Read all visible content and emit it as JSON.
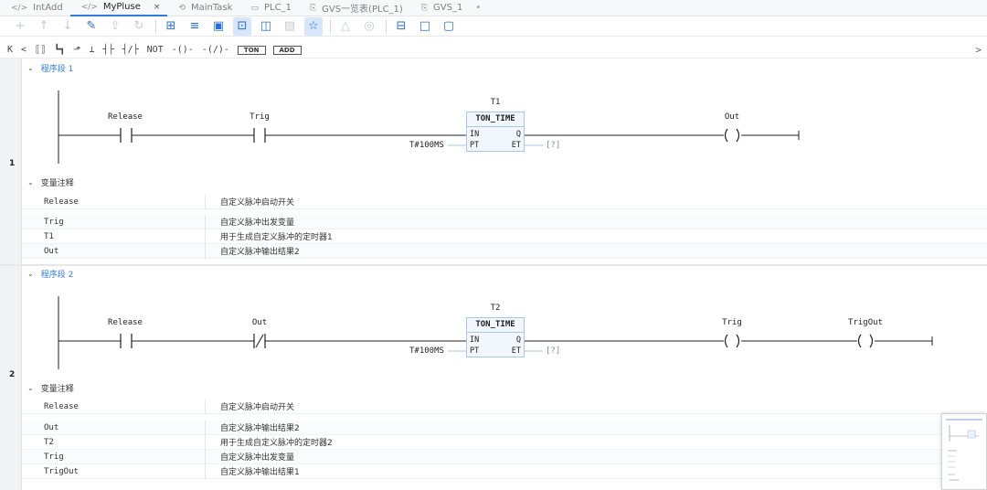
{
  "tabs": [
    {
      "icon": "</>",
      "label": "IntAdd",
      "active": false
    },
    {
      "icon": "</>",
      "label": "MyPluse",
      "active": true,
      "close": "×"
    },
    {
      "icon": "⟲",
      "label": "MainTask",
      "active": false
    },
    {
      "icon": "▭",
      "label": "PLC_1",
      "active": false
    },
    {
      "icon": "⎘",
      "label": "GVS一览表(PLC_1)",
      "active": false
    },
    {
      "icon": "⎘",
      "label": "GVS_1",
      "active": false,
      "dot": "•"
    }
  ],
  "toolbar": [
    {
      "icon": "plus-icon",
      "glyph": "+",
      "disabled": true
    },
    {
      "icon": "arrow-up-icon",
      "glyph": "↑",
      "disabled": true
    },
    {
      "icon": "arrow-down-icon",
      "glyph": "↓",
      "disabled": true
    },
    {
      "icon": "edit-icon",
      "glyph": "✎",
      "disabled": false
    },
    {
      "icon": "export-icon",
      "glyph": "⇪",
      "disabled": true
    },
    {
      "icon": "refresh-icon",
      "glyph": "↻",
      "disabled": true
    },
    {
      "sep": true
    },
    {
      "icon": "insert-row-icon",
      "glyph": "⊞",
      "disabled": false
    },
    {
      "icon": "list-icon",
      "glyph": "≡",
      "disabled": false
    },
    {
      "icon": "monitor-icon",
      "glyph": "▣",
      "disabled": false
    },
    {
      "icon": "ladder-view-icon",
      "glyph": "⊡",
      "disabled": false,
      "selected": true
    },
    {
      "icon": "chat-icon",
      "glyph": "◫",
      "disabled": false
    },
    {
      "icon": "image-icon",
      "glyph": "▧",
      "disabled": true
    },
    {
      "icon": "star-icon",
      "glyph": "☆",
      "disabled": false,
      "selected": true
    },
    {
      "sep": true
    },
    {
      "icon": "warning-icon",
      "glyph": "△",
      "disabled": true
    },
    {
      "icon": "eye-icon",
      "glyph": "◎",
      "disabled": true
    },
    {
      "sep": true
    },
    {
      "icon": "split-horizontal-icon",
      "glyph": "⊟",
      "disabled": false
    },
    {
      "icon": "square-icon",
      "glyph": "□",
      "disabled": false
    },
    {
      "icon": "square-outline-icon",
      "glyph": "▢",
      "disabled": false
    }
  ],
  "ladder_bar": {
    "items": [
      "K",
      "<",
      "⟦⟧",
      "┗┓",
      "⬏",
      "⊥",
      "┤├",
      "┤/├",
      "NOT",
      "-()-",
      "-(/)-"
    ],
    "buttons": [
      "TON",
      "ADD"
    ],
    "right_arrow": ">"
  },
  "networks": [
    {
      "number": "1",
      "title": "程序段 1",
      "contacts": [
        "Release",
        "Trig"
      ],
      "block": {
        "instance": "T1",
        "type": "TON_TIME",
        "in": "IN",
        "pt": "PT",
        "q": "Q",
        "et": "ET",
        "pt_value": "T#100MS",
        "et_value": "[?]"
      },
      "coils": [
        "Out"
      ],
      "var_header": "变量注释",
      "vars": [
        {
          "name": "Release",
          "comment": "自定义脉冲启动开关"
        },
        {
          "name": "Trig",
          "comment": "自定义脉冲出发变量"
        },
        {
          "name": "T1",
          "comment": "用于生成自定义脉冲的定时器1"
        },
        {
          "name": "Out",
          "comment": "自定义脉冲输出结果2"
        }
      ]
    },
    {
      "number": "2",
      "title": "程序段 2",
      "contacts": [
        "Release",
        "Out"
      ],
      "block": {
        "instance": "T2",
        "type": "TON_TIME",
        "in": "IN",
        "pt": "PT",
        "q": "Q",
        "et": "ET",
        "pt_value": "T#100MS",
        "et_value": "[?]"
      },
      "coils": [
        "Trig",
        "TrigOut"
      ],
      "var_header": "变量注释",
      "vars": [
        {
          "name": "Release",
          "comment": "自定义脉冲启动开关"
        },
        {
          "name": "Out",
          "comment": "自定义脉冲输出结果2"
        },
        {
          "name": "T2",
          "comment": "用于生成自定义脉冲的定时器2"
        },
        {
          "name": "Trig",
          "comment": "自定义脉冲出发变量"
        },
        {
          "name": "TrigOut",
          "comment": "自定义脉冲输出结果1"
        }
      ]
    }
  ],
  "colors": {
    "accent": "#2f7de1",
    "block_border": "#a9c6ee",
    "block_fill": "#f2f7fd"
  }
}
